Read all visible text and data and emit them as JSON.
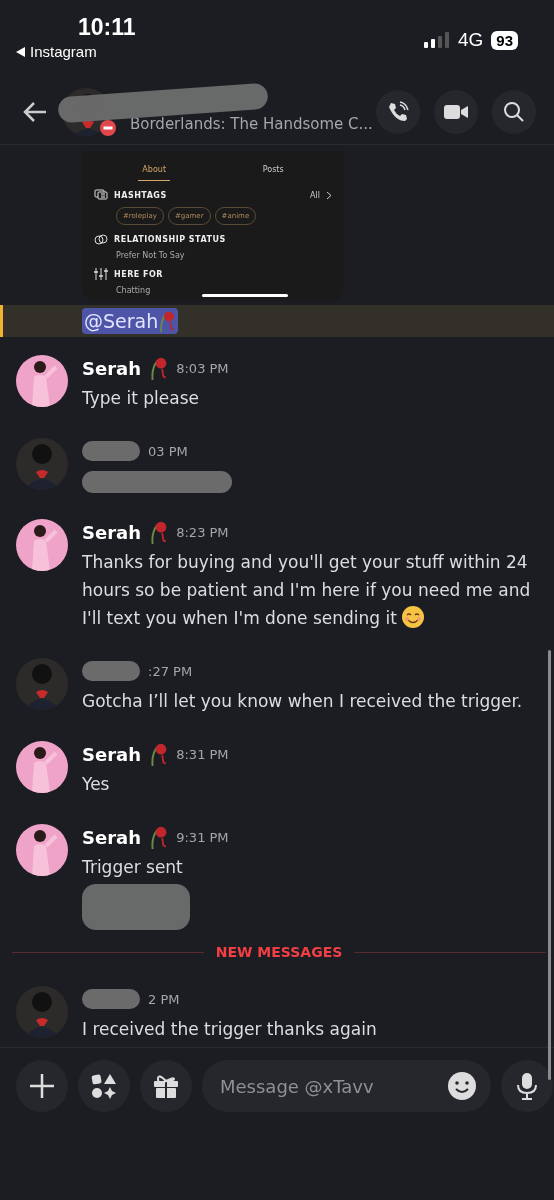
{
  "status_bar": {
    "time": "10:11",
    "back_label": "Instagram",
    "network": "4G",
    "battery": "93"
  },
  "header": {
    "activity": "Borderlands: The Handsome C..."
  },
  "attachment": {
    "tabs": [
      {
        "label": "About",
        "selected": true
      },
      {
        "label": "Posts",
        "selected": false
      }
    ],
    "sections": [
      {
        "kind": "hashtags",
        "title": "HASHTAGS",
        "action": "All",
        "tags": [
          "#roleplay",
          "#gamer",
          "#anime"
        ]
      },
      {
        "kind": "relationship",
        "title": "RELATIONSHIP STATUS",
        "value": "Prefer Not To Say"
      },
      {
        "kind": "here_for",
        "title": "HERE FOR",
        "value": "Chatting"
      }
    ]
  },
  "mention": "@Serah",
  "messages": [
    {
      "kind": "user",
      "author": "Serah",
      "time": "8:03 PM",
      "text": "Type it please"
    },
    {
      "kind": "redacted",
      "time": "03 PM"
    },
    {
      "kind": "user",
      "author": "Serah",
      "time": "8:23 PM",
      "text": "Thanks for buying and you'll get your stuff within 24 hours so be patient and I'm here if you need me and I'll text you when I'm done sending it",
      "emoji": true
    },
    {
      "kind": "redacted",
      "time": ":27 PM",
      "text": "Gotcha I’ll let you know when I received the trigger."
    },
    {
      "kind": "user",
      "author": "Serah",
      "time": "8:31 PM",
      "text": "Yes"
    },
    {
      "kind": "user",
      "author": "Serah",
      "time": "9:31 PM",
      "text": "Trigger sent",
      "redacted_after": true
    },
    {
      "kind": "divider",
      "text": "NEW MESSAGES"
    },
    {
      "kind": "redacted",
      "time": "2 PM",
      "text": "I received the trigger thanks again"
    }
  ],
  "composer": {
    "placeholder": "Message @xTavv"
  }
}
